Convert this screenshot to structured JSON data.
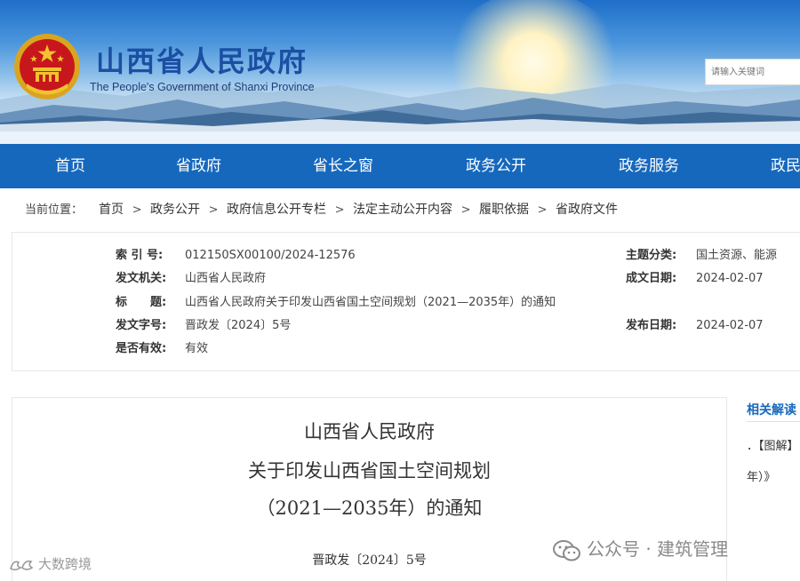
{
  "header": {
    "site_title": "山西省人民政府",
    "site_subtitle": "The People's Government of Shanxi Province",
    "search_placeholder": "请输入关键词"
  },
  "nav": {
    "items": [
      "首页",
      "省政府",
      "省长之窗",
      "政务公开",
      "政务服务",
      "政民"
    ]
  },
  "breadcrumb": {
    "prefix": "当前位置：",
    "items": [
      "首页",
      "政务公开",
      "政府信息公开专栏",
      "法定主动公开内容",
      "履职依据",
      "省政府文件"
    ],
    "separator": ">"
  },
  "meta": {
    "index_label": "索 引 号:",
    "index_value": "012150SX00100/2024-12576",
    "topic_label": "主题分类:",
    "topic_value": "国土资源、能源",
    "issuer_label": "发文机关:",
    "issuer_value": "山西省人民政府",
    "created_label": "成文日期:",
    "created_value": "2024-02-07",
    "title_label": "标　　题:",
    "title_value": "山西省人民政府关于印发山西省国土空间规划（2021—2035年）的通知",
    "docno_label": "发文字号:",
    "docno_value": "晋政发〔2024〕5号",
    "published_label": "发布日期:",
    "published_value": "2024-02-07",
    "valid_label": "是否有效:",
    "valid_value": "有效"
  },
  "document": {
    "line1": "山西省人民政府",
    "line2": "关于印发山西省国土空间规划",
    "line3": "（2021—2035年）的通知",
    "doc_number": "晋政发〔2024〕5号"
  },
  "sidebar": {
    "title": "相关解读",
    "item1": "．【图解】",
    "item2": "年）》"
  },
  "watermarks": {
    "wechat": "公众号 · 建筑管理",
    "left": "大数跨境"
  },
  "colors": {
    "nav_blue": "#1668bd",
    "title_blue": "#1a4fa3",
    "link_blue": "#1668bd"
  }
}
